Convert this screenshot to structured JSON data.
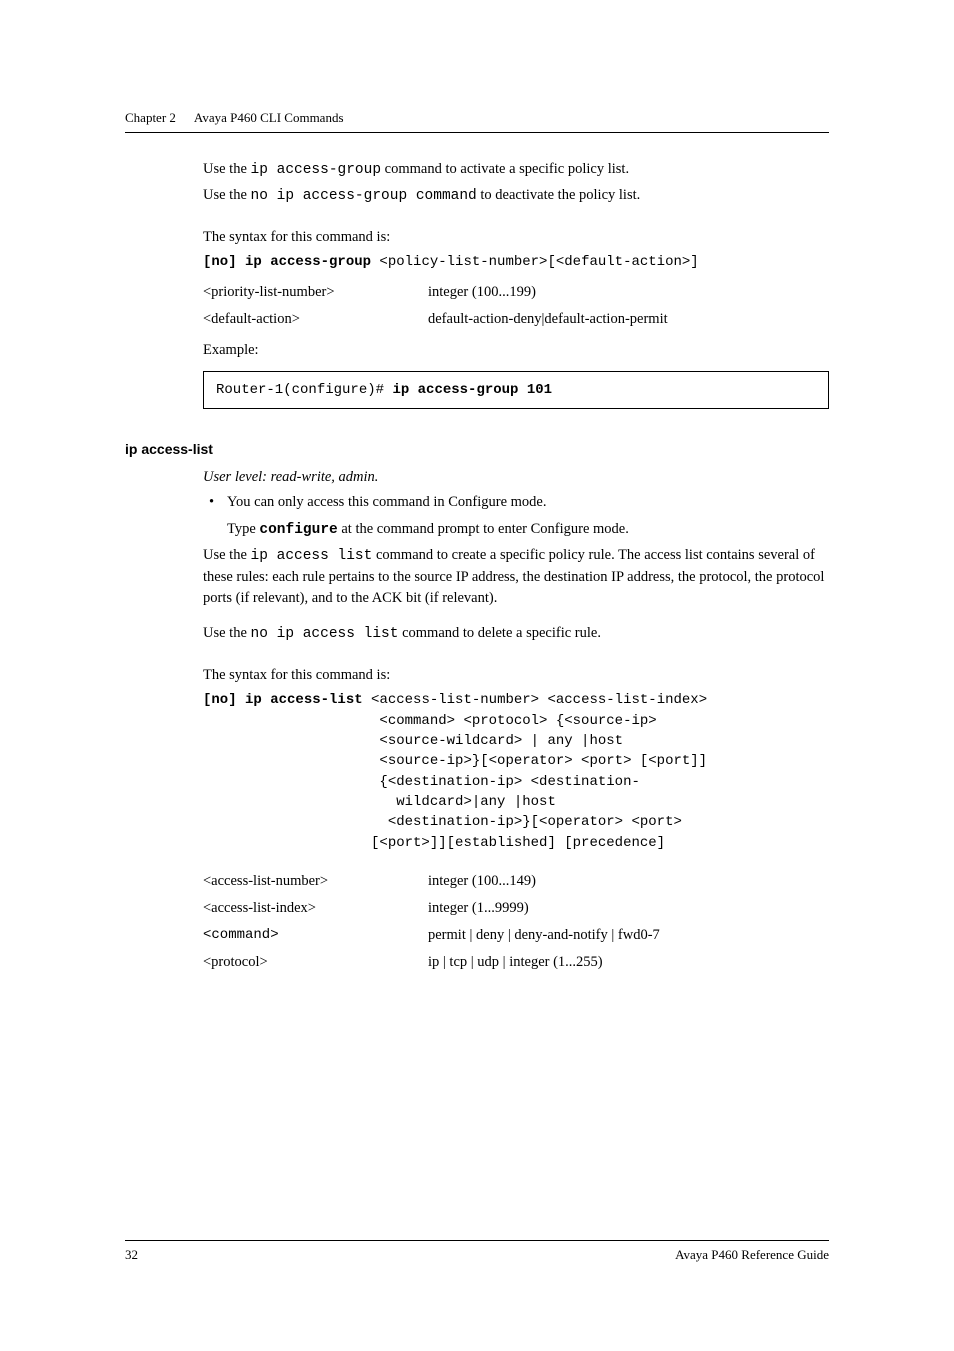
{
  "header": {
    "chapter": "Chapter 2",
    "title": "Avaya P460 CLI Commands"
  },
  "section1": {
    "use_line_prefix": "Use the ",
    "use_cmd1": "ip access-group",
    "use_line_suffix1": " command to activate a specific policy list.",
    "use_line_prefix2": "Use the ",
    "use_cmd2": "no ip access-group command",
    "use_line_suffix2": " to deactivate the policy list.",
    "syntax_lead": "The syntax for this command is:",
    "syntax_bold": "[no] ip access-group",
    "syntax_rest": " <policy-list-number>[<default-action>]",
    "params": [
      {
        "name": "<priority-list-number>",
        "desc": "integer (100...199)"
      },
      {
        "name": "<default-action>",
        "desc": "default-action-deny|default-action-permit"
      }
    ],
    "example_label": "Example:",
    "example_prompt": "Router-1(configure)# ",
    "example_cmd": "ip access-group 101"
  },
  "section2": {
    "heading": "ip access-list",
    "user_level": "User level: read-write, admin.",
    "bullet1": "You can only access this command in Configure mode.",
    "bullet2_prefix": "Type ",
    "bullet2_cmd": "configure",
    "bullet2_suffix": " at the command prompt to enter Configure mode.",
    "use_prefix": "Use the ",
    "use_cmd": "ip access list",
    "use_text": " command to create a specific policy rule. The access list contains several of these rules: each rule pertains to the source IP address, the destination IP address, the protocol, the protocol ports (if relevant), and to the ACK bit (if relevant).",
    "no_prefix": "Use the ",
    "no_cmd": "no ip access list",
    "no_suffix": " command to delete a specific rule.",
    "syntax_lead": "The syntax for this command is:",
    "syntax_bold": "[no] ip access-list",
    "syntax_rest": " <access-list-number> <access-list-index>\n                     <command> <protocol> {<source-ip>\n                     <source-wildcard> | any |host\n                     <source-ip>}[<operator> <port> [<port]]\n                     {<destination-ip> <destination-\n                       wildcard>|any |host\n                      <destination-ip>}[<operator> <port>\n                    [<port>]][established] [precedence]",
    "params": [
      {
        "name": "<access-list-number>",
        "desc": "integer (100...149)"
      },
      {
        "name": "<access-list-index>",
        "desc": "integer (1...9999)"
      },
      {
        "name": "<command>",
        "desc": "permit | deny | deny-and-notify | fwd0-7"
      },
      {
        "name": "<protocol>",
        "desc": "ip | tcp | udp | integer (1...255)"
      }
    ]
  },
  "footer": {
    "page": "32",
    "doc": "Avaya P460 Reference Guide"
  }
}
